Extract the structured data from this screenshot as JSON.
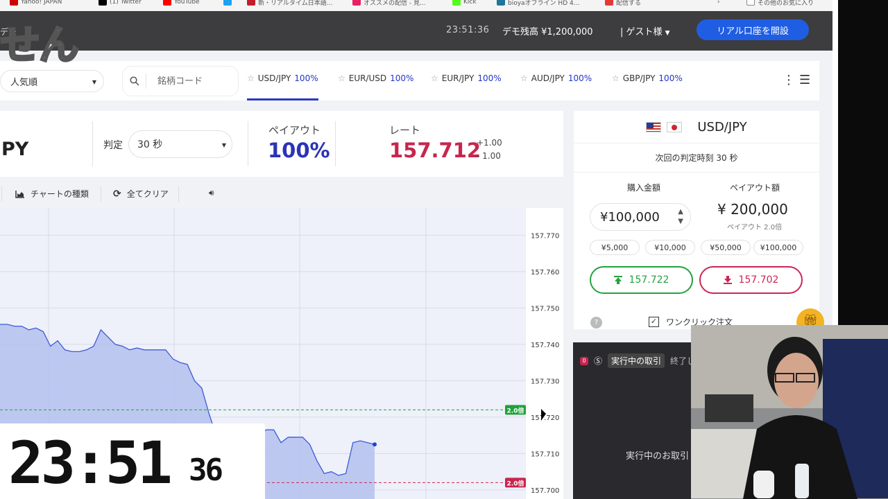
{
  "bookmarks": [
    {
      "label": "Yahoo! JAPAN",
      "color": "#cc0000"
    },
    {
      "label": "(1) Twitter",
      "color": "#000000"
    },
    {
      "label": "YouTube",
      "color": "#ff0000"
    },
    {
      "label": "",
      "color": "#1da1f2"
    },
    {
      "label": "新・リアルタイム日本語...",
      "color": "#c21d2b"
    },
    {
      "label": "オススメの配信 - 見...",
      "color": "#e91e63"
    },
    {
      "label": "Kick",
      "color": "#53fc18"
    },
    {
      "label": "bioyaオフライン HD 4...",
      "color": "#21759b"
    },
    {
      "label": "配信する",
      "color": "#e53935"
    },
    {
      "label": "その他のお気に入り",
      "color": "#888888"
    }
  ],
  "brand_overlay": "せん",
  "topbar": {
    "demo_tag": "デモ",
    "clock": "23:51:36",
    "balance": "デモ残高 ¥1,200,000",
    "guest": "| ゲスト様",
    "open_account": "リアル口座を開設"
  },
  "tabrow": {
    "sort_value": "人気順",
    "search_placeholder": "銘柄コード",
    "tabs": [
      {
        "pair": "USD/JPY",
        "pct": "100%",
        "active": true
      },
      {
        "pair": "EUR/USD",
        "pct": "100%",
        "active": false
      },
      {
        "pair": "EUR/JPY",
        "pct": "100%",
        "active": false
      },
      {
        "pair": "AUD/JPY",
        "pct": "100%",
        "active": false
      },
      {
        "pair": "GBP/JPY",
        "pct": "100%",
        "active": false
      }
    ]
  },
  "infobar": {
    "pair": "PY",
    "judge_label": "判定",
    "judge_value": "30 秒",
    "payout_label": "ペイアウト",
    "payout_value": "100%",
    "rate_label": "レート",
    "rate_value": "157.712",
    "rate_up": "+1.00",
    "rate_down": "- 1.00"
  },
  "charttools": {
    "chart_type": "チャートの種類",
    "clear_all": "全てクリア"
  },
  "chart_data": {
    "type": "area",
    "y_ticks": [
      "157.770",
      "157.760",
      "157.750",
      "157.740",
      "157.730",
      "157.720",
      "157.710",
      "157.700"
    ],
    "ylim": [
      157.6975,
      157.7775
    ],
    "series": [
      {
        "values": [
          157.7455,
          157.7455,
          157.745,
          157.745,
          157.744,
          157.7445,
          157.7435,
          157.7395,
          157.741,
          157.7385,
          157.738,
          157.738,
          157.7385,
          157.7395,
          157.744,
          157.742,
          157.74,
          157.7395,
          157.7385,
          157.739,
          157.7385,
          157.7385,
          157.7385,
          157.7385,
          157.736,
          157.735,
          157.7345,
          157.73,
          157.728,
          157.721,
          157.715,
          157.715,
          157.715,
          157.715,
          157.715,
          157.715,
          157.7155,
          157.7165,
          157.7165,
          157.713,
          157.7145,
          157.7145,
          157.7145,
          157.7125,
          157.708,
          157.7045,
          157.705,
          157.704,
          157.7045,
          157.713,
          157.7135,
          157.713,
          157.7125
        ]
      }
    ],
    "markers": [
      {
        "label": "2.0倍",
        "value": 157.722,
        "color": "#22a03a"
      },
      {
        "label": "2.0倍",
        "value": 157.702,
        "color": "#c8254d"
      }
    ]
  },
  "order": {
    "pair": "USD/JPY",
    "next_judge": "次回の判定時刻 30 秒",
    "amount_label": "購入金額",
    "payout_label": "ペイアウト額",
    "amount": "¥100,000",
    "payout_amount": "¥ 200,000",
    "payout_mult": "ペイアウト 2.0倍",
    "chips": [
      "¥5,000",
      "¥10,000",
      "¥50,000",
      "¥100,000"
    ],
    "high_price": "157.722",
    "low_price": "157.702",
    "one_click": "ワンクリック注文"
  },
  "trades": {
    "count": "0",
    "title": "実行中の取引",
    "title_cut": "終了し",
    "empty": "実行中のお取引"
  },
  "clock_overlay": {
    "hm": "23:51",
    "sec": "36"
  }
}
